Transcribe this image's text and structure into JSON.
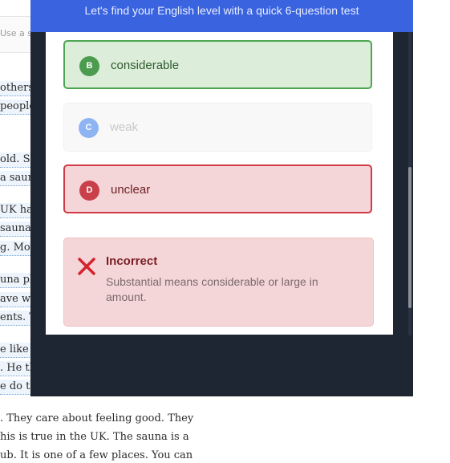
{
  "modal": {
    "title": "Let's find your English level with a quick 6-question test",
    "options": [
      {
        "letter": "B",
        "text": "considerable",
        "state": "correct"
      },
      {
        "letter": "C",
        "text": "weak",
        "state": "disabled"
      },
      {
        "letter": "D",
        "text": "unclear",
        "state": "incorrect"
      }
    ],
    "feedback": {
      "title": "Incorrect",
      "text": "Substantial means considerable or large in amount.",
      "icon": "x-icon"
    }
  },
  "article": {
    "search_fragment": "Use a sa",
    "fragments": [
      "others",
      "people",
      "old. Sh",
      "a sauna",
      "UK has",
      "saunas",
      "g. Mor",
      "una pla",
      "ave wo",
      "ents. T",
      "e like it",
      ". He thi",
      "e do th",
      ". They care about feeling good. They",
      "his is true in the UK. The sauna is a",
      "ub. It is one of a few places. You can"
    ]
  },
  "colors": {
    "header": "#3a63e0",
    "modal_bg": "#1f2633",
    "correct": "#4ca552",
    "incorrect": "#cf3a45"
  }
}
